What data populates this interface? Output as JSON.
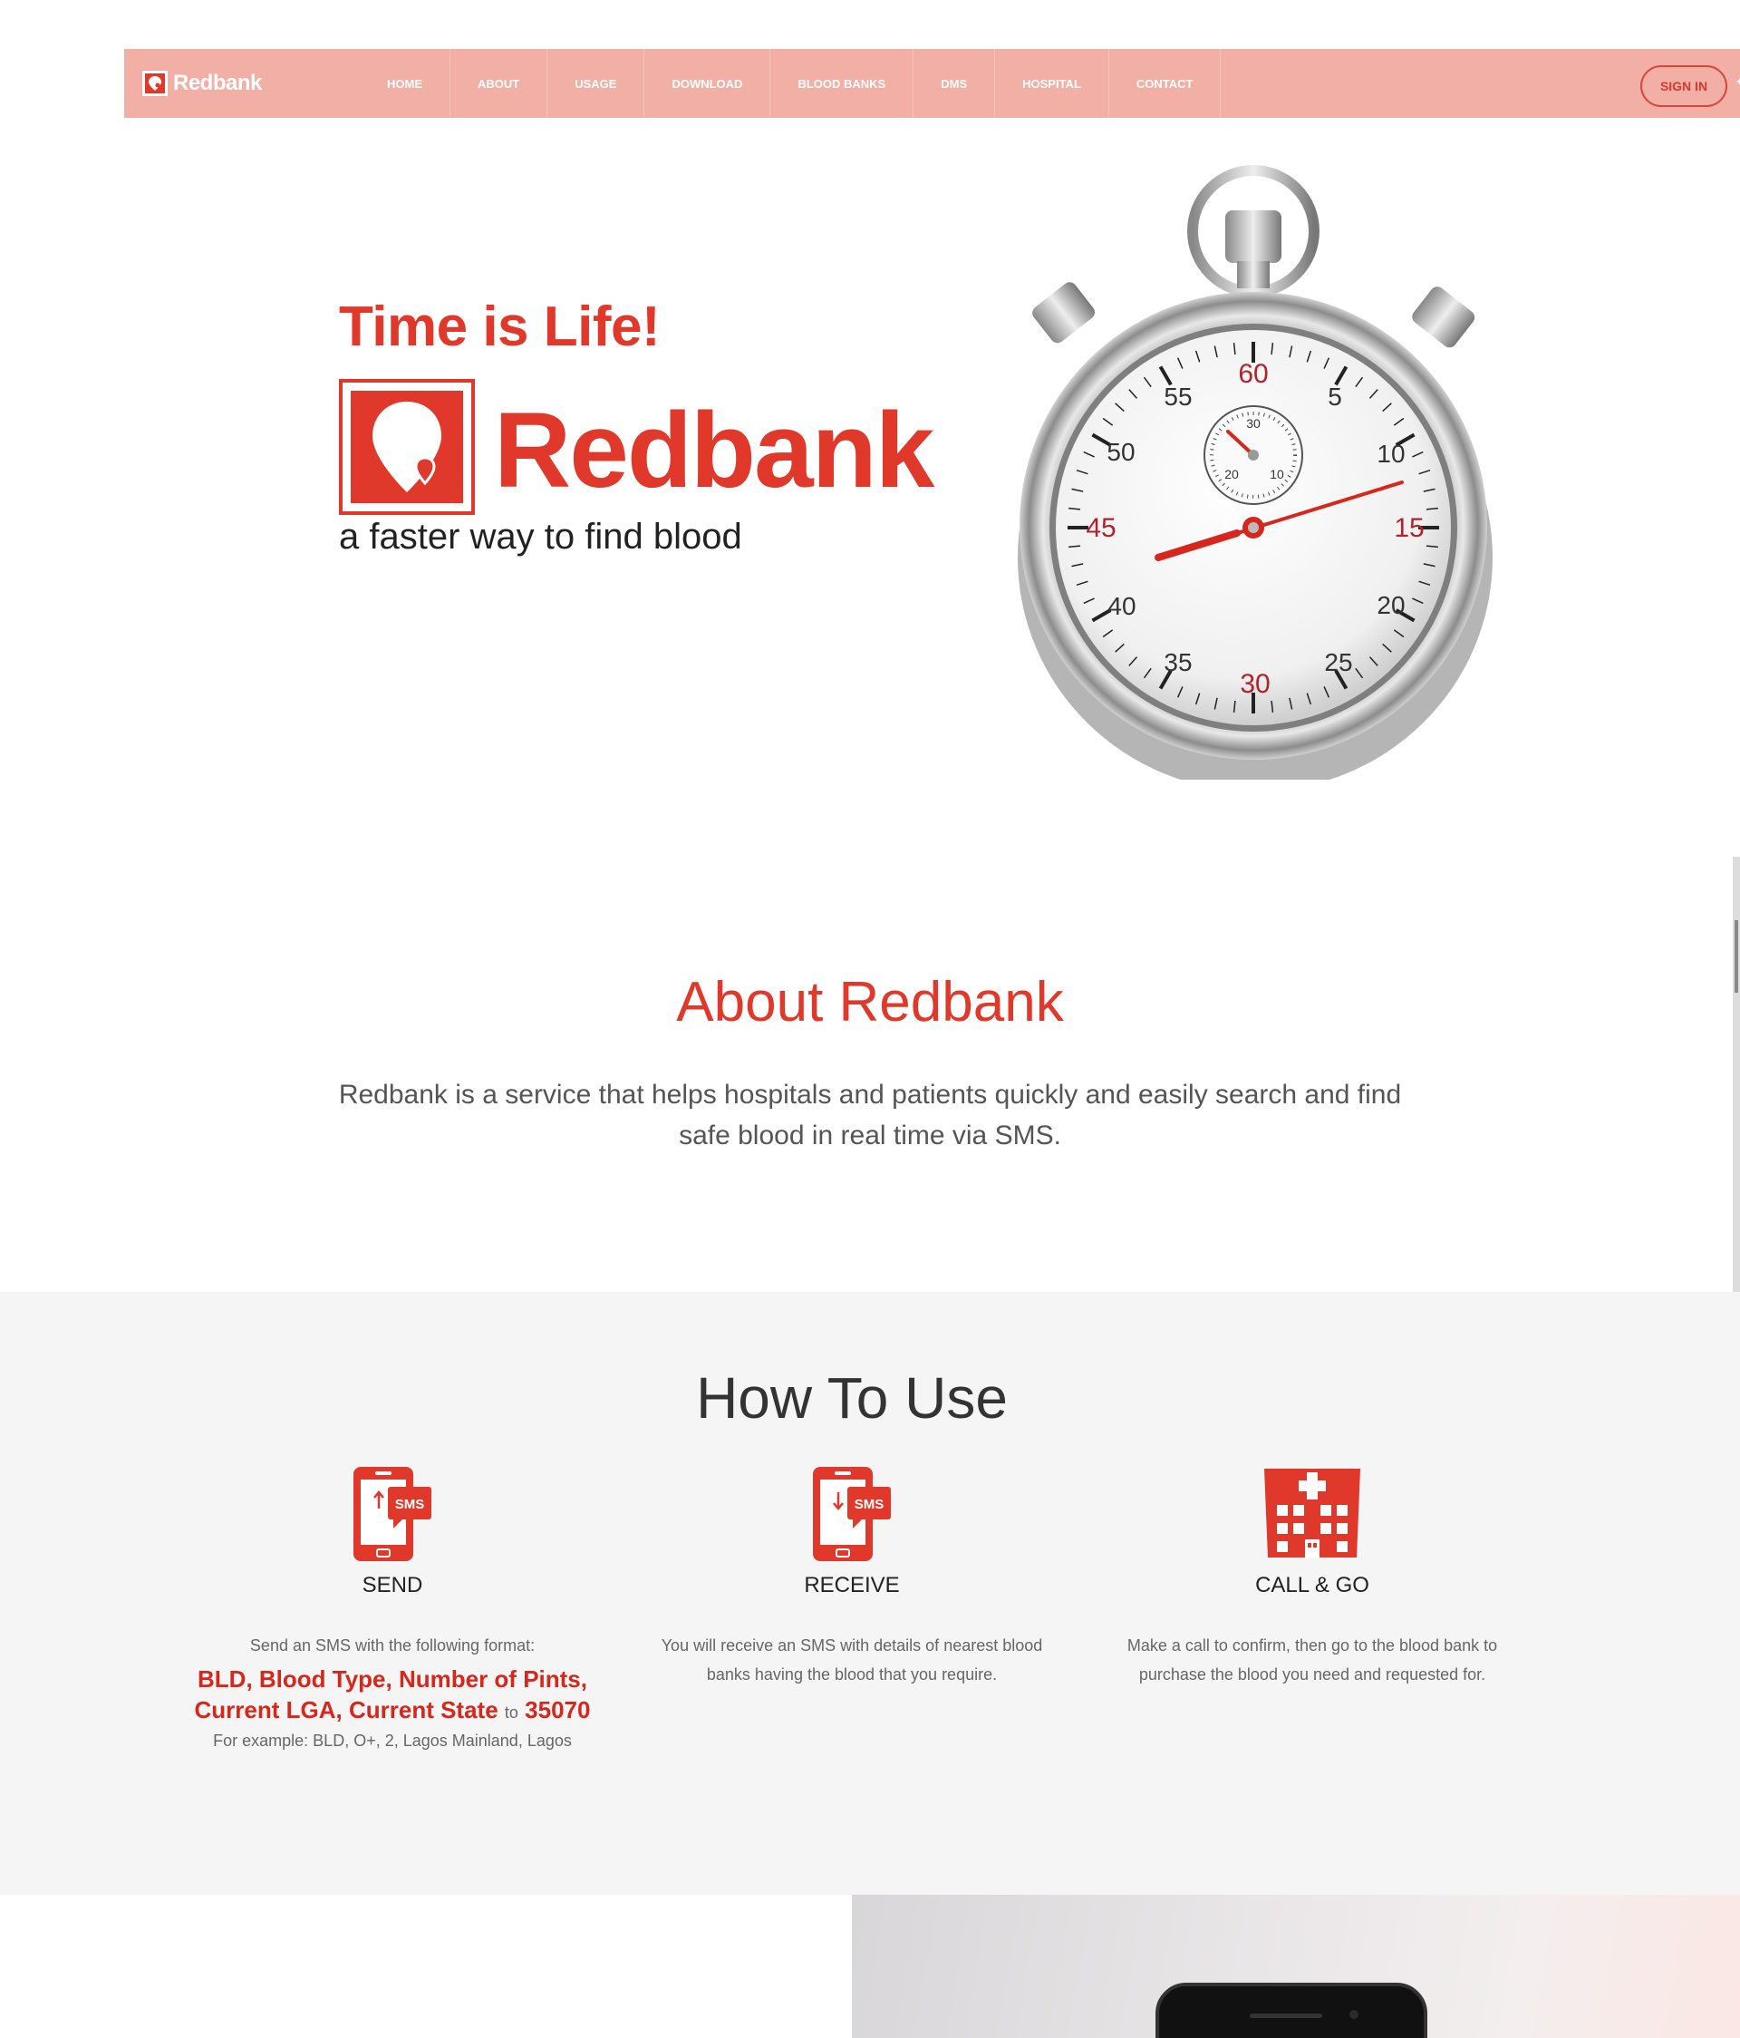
{
  "nav": {
    "brand": "Redbank",
    "items": [
      "HOME",
      "ABOUT",
      "USAGE",
      "DOWNLOAD",
      "BLOOD BANKS",
      "DMS",
      "HOSPITAL",
      "CONTACT"
    ],
    "signin": "SIGN IN"
  },
  "hero": {
    "tagline": "Time is Life!",
    "logo_text": "Redbank",
    "subtitle": "a faster way to find blood",
    "stopwatch_numbers": [
      "60",
      "5",
      "10",
      "15",
      "20",
      "25",
      "30",
      "35",
      "40",
      "45",
      "50",
      "55"
    ],
    "subdial_numbers": [
      "30",
      "10",
      "20"
    ]
  },
  "about": {
    "title": "About Redbank",
    "text": "Redbank is a service that helps hospitals and patients quickly and easily search and find safe blood in real time via SMS."
  },
  "howto": {
    "title": "How To Use",
    "steps": [
      {
        "label": "SEND",
        "icon": "phone-sms-send-icon",
        "icon_text": "SMS",
        "desc": "Send an SMS with the following format:",
        "format_line1": "BLD, Blood Type, Number of Pints,",
        "format_line2": "Current LGA, Current State",
        "format_to": "to",
        "format_number": "35070",
        "example": "For example: BLD, O+, 2, Lagos Mainland, Lagos"
      },
      {
        "label": "RECEIVE",
        "icon": "phone-sms-receive-icon",
        "icon_text": "SMS",
        "desc": "You will receive an SMS with details of nearest blood banks having the blood that you require."
      },
      {
        "label": "CALL & GO",
        "icon": "hospital-building-icon",
        "desc": "Make a call to confirm, then go to the blood bank to purchase the blood you need and requested for."
      }
    ]
  },
  "colors": {
    "brand_red": "#e0392b",
    "nav_bg": "#f2afa6",
    "section_gray": "#f5f5f5"
  }
}
